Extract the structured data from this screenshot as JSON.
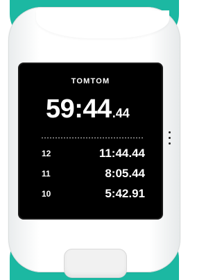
{
  "device": {
    "brand": "TOMTOM",
    "colors": {
      "strap": "#1cb8a2",
      "housing": "#ffffff",
      "screen": "#000000",
      "text": "#ffffff"
    }
  },
  "display": {
    "main_time": "59:44",
    "main_hundredths": ".44",
    "laps": [
      {
        "number": "12",
        "time": "11:44.44"
      },
      {
        "number": "11",
        "time": "8:05.44"
      },
      {
        "number": "10",
        "time": "5:42.91"
      }
    ]
  },
  "controls": {
    "menu_icon": "vertical-dots-icon",
    "button": "control-button"
  }
}
